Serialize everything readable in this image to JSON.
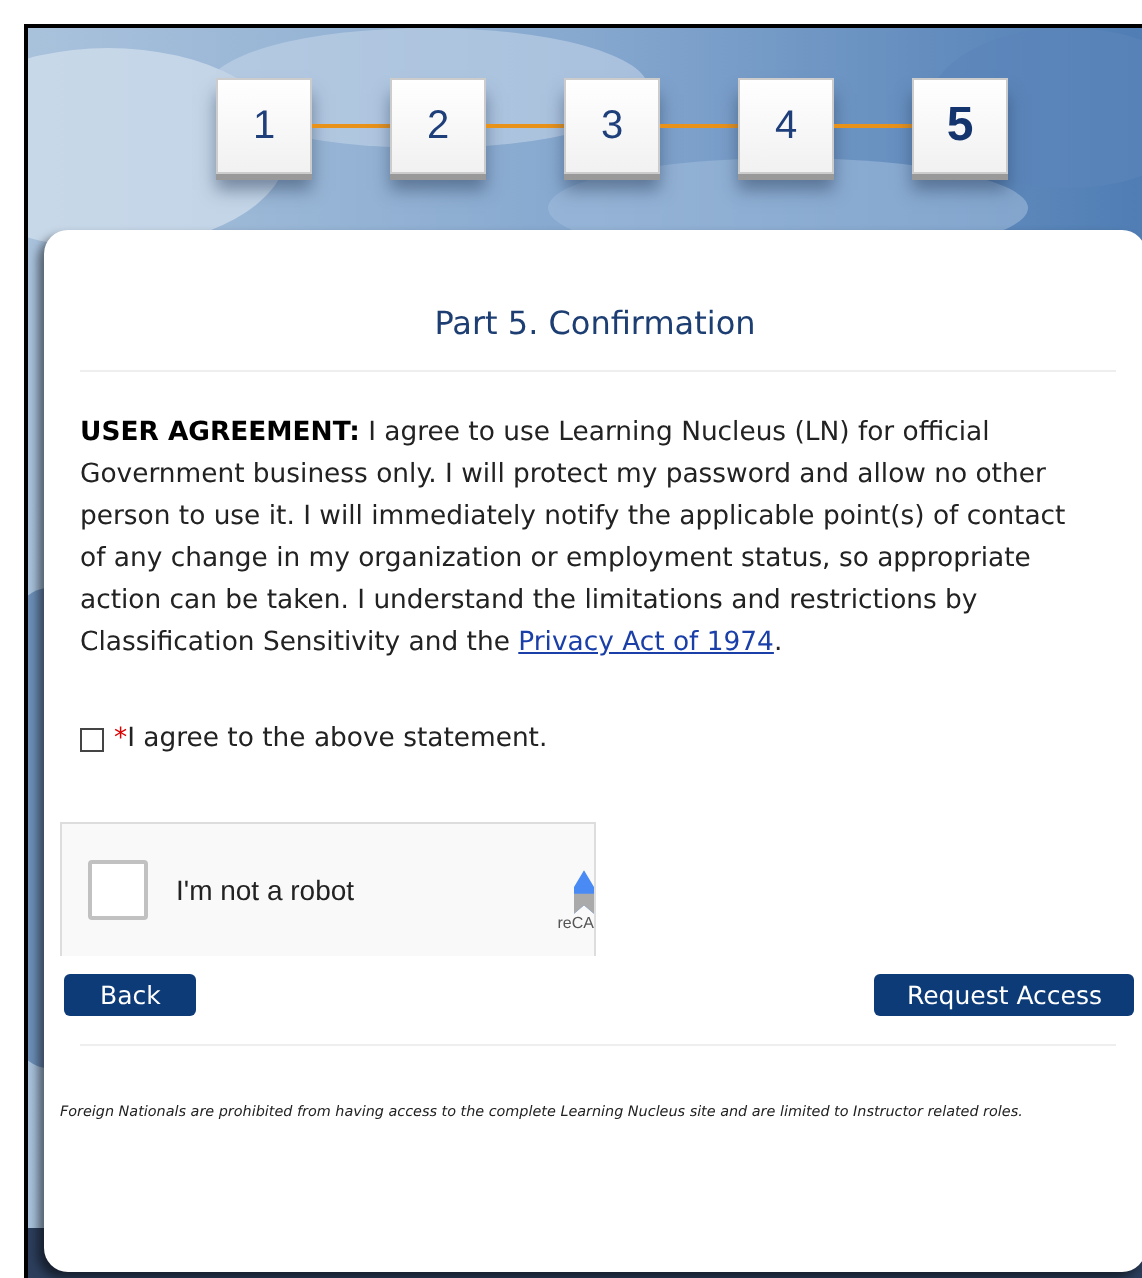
{
  "steps": [
    {
      "label": "1",
      "selected": false
    },
    {
      "label": "2",
      "selected": false
    },
    {
      "label": "3",
      "selected": false
    },
    {
      "label": "4",
      "selected": false
    },
    {
      "label": "5",
      "selected": true
    }
  ],
  "title": "Part 5. Confirmation",
  "agreement": {
    "text": "**USER AGREEMENT:** I agree to use Learning Nucleus (LN) for official Government business only. I will protect my password and allow no other person to use it. I will immediately notify the applicable point(s) of contact of any change in my organization or employment status, so appropriate action can be taken. I understand the limitations and restrictions by Classification Sensitivity and the",
    "link": "Privacy Act of 1974",
    "end": "."
  },
  "agree_checkbox": {
    "required_mark": "*",
    "label": "I agree to the above statement.",
    "checked": false
  },
  "captcha": {
    "label": "I'm not a robot",
    "checked": false,
    "brand": "reCA"
  },
  "buttons": [
    {
      "label": "Back",
      "kind": "left"
    },
    {
      "label": "Request Access",
      "kind": "right"
    }
  ],
  "footer": "Foreign Nationals are prohibited from having access to the complete Learning Nucleus site and are limited to Instructor related roles."
}
